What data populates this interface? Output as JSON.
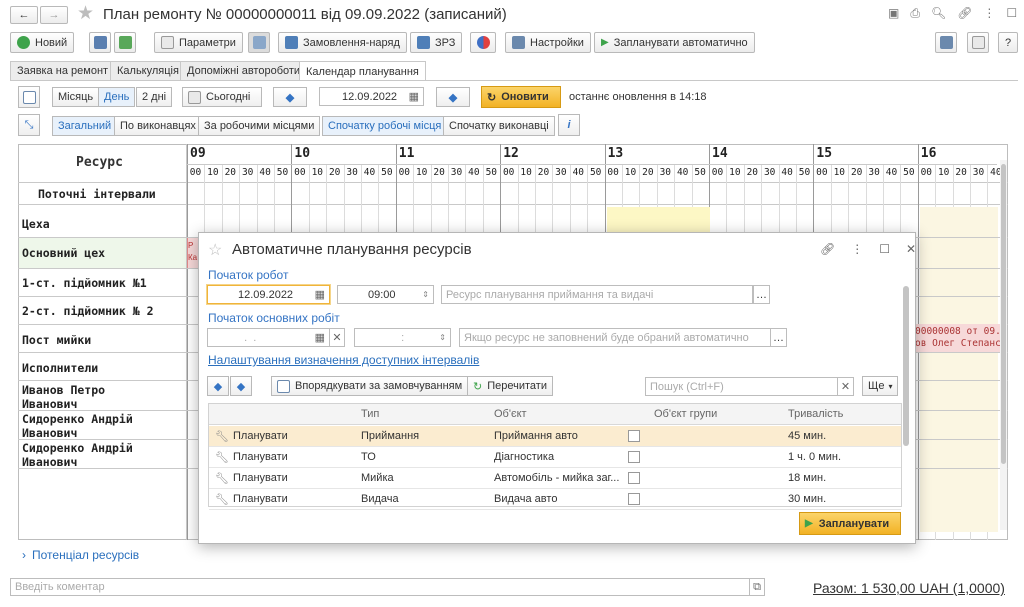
{
  "window": {
    "title": "План ремонту № 00000000011 від 09.09.2022 (записаний)"
  },
  "toolbar": {
    "new": "Новий",
    "params": "Параметри",
    "order": "Замовлення-наряд",
    "zrz": "ЗРЗ",
    "settings": "Настройки",
    "auto_plan": "Запланувати автоматично"
  },
  "tabs": [
    "Заявка на ремонт",
    "Калькуляція",
    "Допоміжні авторoботи",
    "Календар планування"
  ],
  "calendar": {
    "view_buttons": [
      "Місяць",
      "День",
      "2 дні"
    ],
    "today": "Сьогодні",
    "date": "12.09.2022",
    "refresh": "Оновити",
    "last_update": "останнє оновлення в 14:18",
    "group_buttons": [
      "Загальний",
      "По виконавцях",
      "За робочими місцями"
    ],
    "order_buttons": [
      "Спочатку робочі місця",
      "Спочатку виконавці"
    ],
    "resource_header": "Ресурс",
    "current_intervals": "Поточні інтервали",
    "hours": [
      "09",
      "10",
      "11",
      "12",
      "13",
      "14",
      "15",
      "16"
    ],
    "minutes": [
      "00",
      "10",
      "20",
      "30",
      "40",
      "50"
    ],
    "rows": [
      "Цеха",
      "Основний цех",
      "1-ст. підйомник №1",
      "2-ст. підйомник № 2",
      "Пост мийки",
      "Исполнители",
      "Иванов Петро Иванович",
      "Сидоренко Андрій Иванович",
      "Сидоренко Андрій Иванович"
    ],
    "event_text_1": "00000008 от 09.",
    "event_text_2": "ов Олег Степанс",
    "event_left_1": "Р",
    "event_left_2": "Ка"
  },
  "dialog": {
    "title": "Автоматичне планування ресурсів",
    "start_label": "Початок робот",
    "start_date": "12.09.2022",
    "start_time": "09:00",
    "resource_placeholder": "Ресурс планування приймання та видачі",
    "main_start_label": "Початок основних робіт",
    "main_date_placeholder": "  .  .    ",
    "main_time_placeholder": "  :  ",
    "main_resource_placeholder": "Якщо ресурс не заповнений буде обраний автоматично",
    "intervals_link": "Налаштування визначення доступних інтервалів",
    "sort_button": "Впорядкувати за замовчуванням",
    "reread_button": "Перечитати",
    "search_placeholder": "Пошук (Ctrl+F)",
    "more": "Ще",
    "columns": [
      "Тип",
      "Об'єкт",
      "Об'єкт групи",
      "Тривалість"
    ],
    "rows": [
      {
        "action": "Планувати",
        "type": "Приймання",
        "object": "Приймання авто",
        "duration": "45 мин."
      },
      {
        "action": "Планувати",
        "type": "ТО",
        "object": "Діагностика",
        "duration": "1 ч. 0 мин."
      },
      {
        "action": "Планувати",
        "type": "Мийка",
        "object": "Автомобіль - мийка заг...",
        "duration": "18 мин."
      },
      {
        "action": "Планувати",
        "type": "Видача",
        "object": "Видача авто",
        "duration": "30 мин."
      }
    ],
    "plan_button": "Запланувати"
  },
  "footer": {
    "potential": "Потенціал ресурсів",
    "comment_placeholder": "Введіть коментар",
    "total": "Разом: 1 530,00 UAH (1,0000)"
  }
}
